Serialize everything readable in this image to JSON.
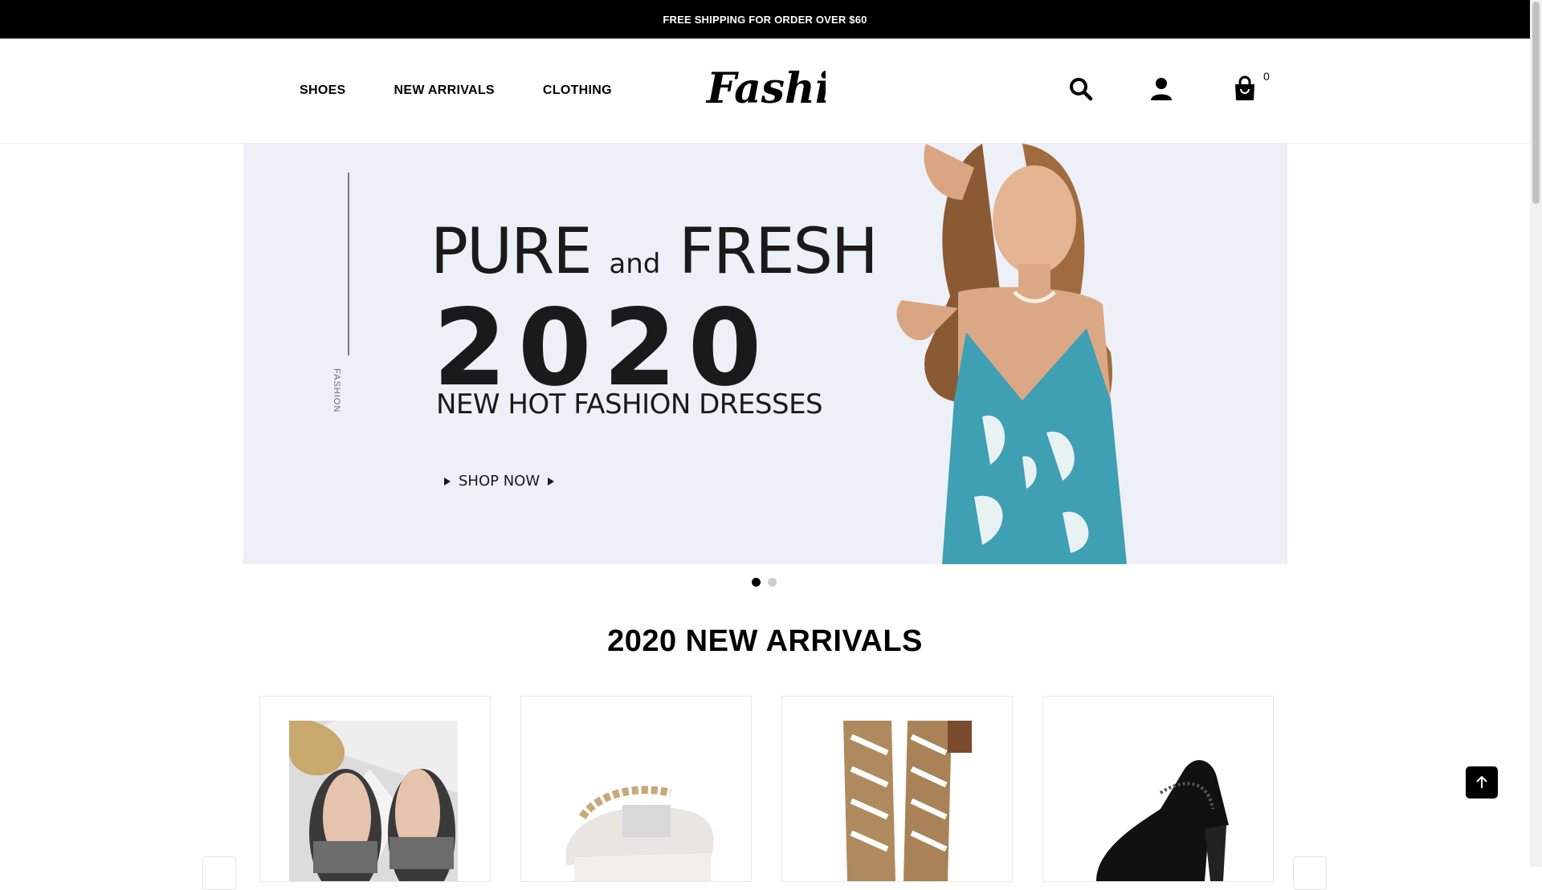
{
  "topbar": {
    "text": "FREE SHIPPING FOR ORDER OVER $60"
  },
  "header": {
    "nav": [
      "SHOES",
      "NEW ARRIVALS",
      "CLOTHING"
    ],
    "logo_text": "Fashion",
    "cart_count": "0",
    "icons": [
      "search-icon",
      "account-icon",
      "cart-icon"
    ]
  },
  "hero": {
    "side_text": "FASHION",
    "line1_a": "PURE ",
    "line1_b": "and",
    "line1_c": " FRESH",
    "year": "2020",
    "subtitle": "NEW HOT FASHION DRESSES",
    "cta": "SHOP NOW",
    "slides_total": 2,
    "active_slide": 1
  },
  "section": {
    "title": "2020 NEW ARRIVALS"
  },
  "products": [
    {
      "name": "jeweled-toe-ring-sandal"
    },
    {
      "name": "white-chain-platform-sandal"
    },
    {
      "name": "tan-lace-up-cutout-boot"
    },
    {
      "name": "black-mesh-block-heel-sandal"
    }
  ],
  "colors": {
    "topbar": "#000000",
    "hero_bg": "#eef0f7",
    "dress": "#3f9fb3"
  }
}
